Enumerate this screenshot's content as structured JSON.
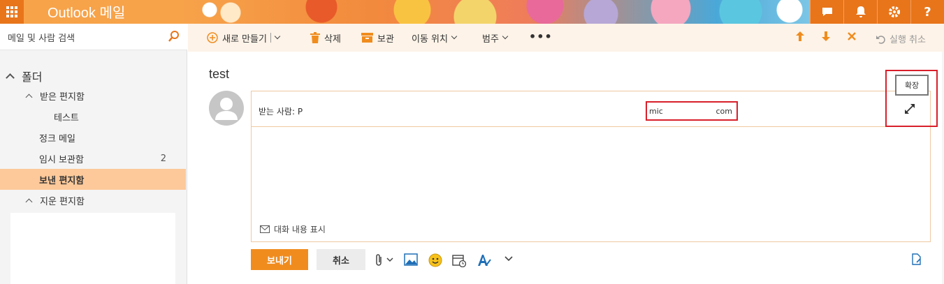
{
  "header": {
    "brand": "Outlook 메일",
    "buttons": [
      "chat-icon",
      "bell-icon",
      "gear-icon",
      "help-icon"
    ]
  },
  "sidebar": {
    "search_placeholder": "메일 및 사람 검색",
    "folder_header": "폴더",
    "items": [
      {
        "label": "받은 편지함",
        "count": ""
      },
      {
        "label": "테스트",
        "count": ""
      },
      {
        "label": "정크 메일",
        "count": ""
      },
      {
        "label": "임시 보관함",
        "count": "2"
      },
      {
        "label": "보낸 편지함",
        "count": ""
      },
      {
        "label": "지운 편지함",
        "count": ""
      }
    ],
    "selected": "보낸 편지함"
  },
  "toolbar": {
    "new_label": "새로 만들기",
    "delete_label": "삭제",
    "archive_label": "보관",
    "move_label": "이동 위치",
    "category_label": "범주",
    "more_label": "•••",
    "undo_label": "실행 취소"
  },
  "message": {
    "subject": "test",
    "to_label": "받는 사람: P",
    "address_start": "mic",
    "address_end": "com",
    "expand_tooltip": "확장",
    "show_conversation": "대화 내용 표시"
  },
  "actions": {
    "send": "보내기",
    "cancel": "취소"
  },
  "colors": {
    "accent": "#f08c1e",
    "header_dark": "#e8751a",
    "selected_folder": "#fdc99a",
    "highlight_box": "#d81f2a"
  }
}
